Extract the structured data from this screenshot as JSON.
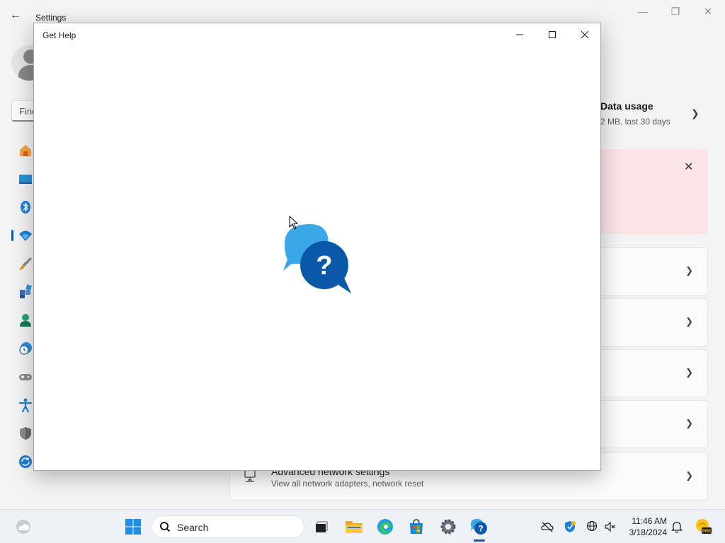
{
  "settings": {
    "title": "Settings",
    "search_placeholder": "Find",
    "data_usage": {
      "title": "Data usage",
      "subtitle": "2 MB, last 30 days"
    },
    "advanced": {
      "title": "Advanced network settings",
      "subtitle": "View all network adapters, network reset"
    },
    "nav_icons": [
      "home-icon",
      "system-icon",
      "bluetooth-icon",
      "wifi-icon",
      "personalization-icon",
      "apps-icon",
      "accounts-icon",
      "time-language-icon",
      "gaming-icon",
      "accessibility-icon",
      "privacy-security-icon",
      "windows-update-icon"
    ]
  },
  "get_help": {
    "title": "Get Help",
    "logo_glyph": "?"
  },
  "taskbar": {
    "search_label": "Search",
    "time": "11:46 AM",
    "date": "3/18/2024",
    "colors": {
      "accent": "#005fb8",
      "help_blue": "#0a58a8",
      "help_light": "#3aa8e8"
    }
  }
}
